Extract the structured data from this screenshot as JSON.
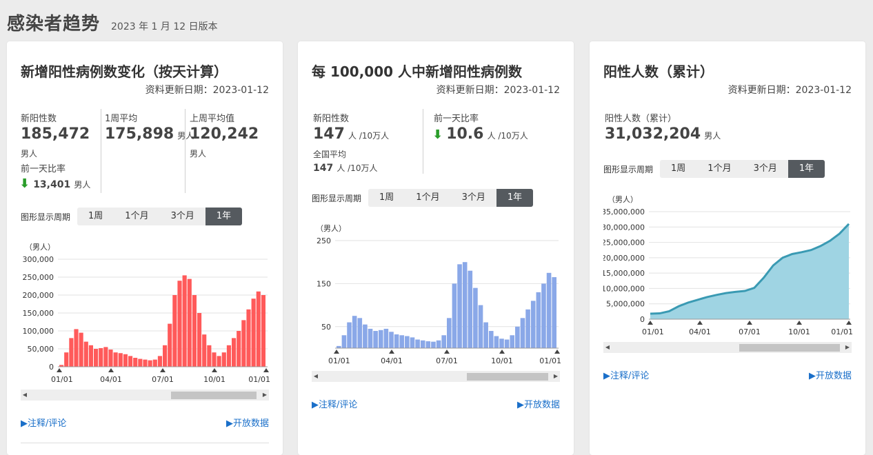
{
  "header": {
    "title": "感染者趋势",
    "version": "2023 年 1 月 12 日版本"
  },
  "cards": [
    {
      "title": "新增阳性病例数变化（按天计算）",
      "update": "资料更新日期：2023-01-12",
      "stats": {
        "new_label": "新阳性数",
        "new_value": "185,472",
        "new_unit": "男人",
        "prev_label": "前一天比率",
        "prev_value": "13,401",
        "prev_unit": "男人",
        "week_label": "1周平均",
        "week_value": "175,898",
        "week_unit": "男人",
        "lastweek_label": "上周平均值",
        "lastweek_value": "120,242",
        "lastweek_unit": "男人"
      },
      "period": {
        "label": "图形显示周期",
        "options": [
          "1周",
          "1个月",
          "3个月",
          "1年"
        ],
        "active": "1年"
      },
      "chart_data": {
        "type": "bar",
        "ylabel": "（男人）",
        "yticks": [
          "300,000",
          "250,000",
          "200,000",
          "150,000",
          "100,000",
          "50,000",
          "0"
        ],
        "xticks": [
          "01/01",
          "04/01",
          "07/01",
          "10/01",
          "01/01"
        ],
        "ylim": [
          0,
          300000
        ],
        "color": "#ff5a5a",
        "values": [
          5000,
          40000,
          80000,
          105000,
          95000,
          70000,
          60000,
          50000,
          52000,
          55000,
          48000,
          40000,
          38000,
          35000,
          30000,
          25000,
          22000,
          20000,
          18000,
          20000,
          30000,
          60000,
          120000,
          200000,
          240000,
          255000,
          245000,
          200000,
          150000,
          90000,
          60000,
          40000,
          30000,
          40000,
          60000,
          80000,
          100000,
          130000,
          160000,
          190000,
          210000,
          200000
        ]
      },
      "links": {
        "notes": "▶注释/评论",
        "open": "▶开放数据"
      }
    },
    {
      "title": "每 100,000 人中新增阳性病例数",
      "update": "资料更新日期：2023-01-12",
      "stats": {
        "new_label": "新阳性数",
        "new_value": "147",
        "new_unit": "人 /10万人",
        "national_label": "全国平均",
        "national_value": "147",
        "national_unit": "人 /10万人",
        "prev_label": "前一天比率",
        "prev_value": "10.6",
        "prev_unit": "人 /10万人"
      },
      "period": {
        "label": "图形显示周期",
        "options": [
          "1周",
          "1个月",
          "3个月",
          "1年"
        ],
        "active": "1年"
      },
      "chart_data": {
        "type": "bar",
        "ylabel": "（男人）",
        "yticks": [
          "250",
          "150",
          "50"
        ],
        "xticks": [
          "01/01",
          "04/01",
          "07/01",
          "10/01",
          "01/01"
        ],
        "ylim": [
          0,
          250
        ],
        "color": "#8aa8e8",
        "values": [
          5,
          30,
          60,
          75,
          70,
          55,
          45,
          40,
          42,
          45,
          38,
          32,
          30,
          28,
          25,
          20,
          18,
          16,
          15,
          18,
          30,
          70,
          150,
          195,
          200,
          180,
          140,
          100,
          60,
          40,
          28,
          22,
          20,
          30,
          50,
          70,
          90,
          110,
          130,
          150,
          175,
          165
        ]
      },
      "links": {
        "notes": "▶注释/评论",
        "open": "▶开放数据"
      }
    },
    {
      "title": "阳性人数（累计）",
      "update": "资料更新日期：2023-01-12",
      "stats": {
        "total_label": "阳性人数（累计）",
        "total_value": "31,032,204",
        "total_unit": "男人"
      },
      "period": {
        "label": "图形显示周期",
        "options": [
          "1周",
          "1个月",
          "3个月",
          "1年"
        ],
        "active": "1年"
      },
      "chart_data": {
        "type": "area",
        "ylabel": "（男人）",
        "yticks": [
          "35,000,000",
          "30,000,000",
          "25,000,000",
          "20,000,000",
          "15,000,000",
          "10,000,000",
          "5,000,000",
          "0"
        ],
        "xticks": [
          "01/01",
          "04/01",
          "07/01",
          "10/01",
          "01/01"
        ],
        "ylim": [
          0,
          35000000
        ],
        "color": "#9fd4e3",
        "line_color": "#3a9ab3",
        "values": [
          1800000,
          1900000,
          2600000,
          4200000,
          5400000,
          6300000,
          7200000,
          7900000,
          8500000,
          8900000,
          9200000,
          10200000,
          13500000,
          17500000,
          20000000,
          21200000,
          21800000,
          22500000,
          23800000,
          25500000,
          27800000,
          31000000
        ]
      },
      "links": {
        "notes": "▶注释/评论",
        "open": "▶开放数据"
      }
    }
  ]
}
